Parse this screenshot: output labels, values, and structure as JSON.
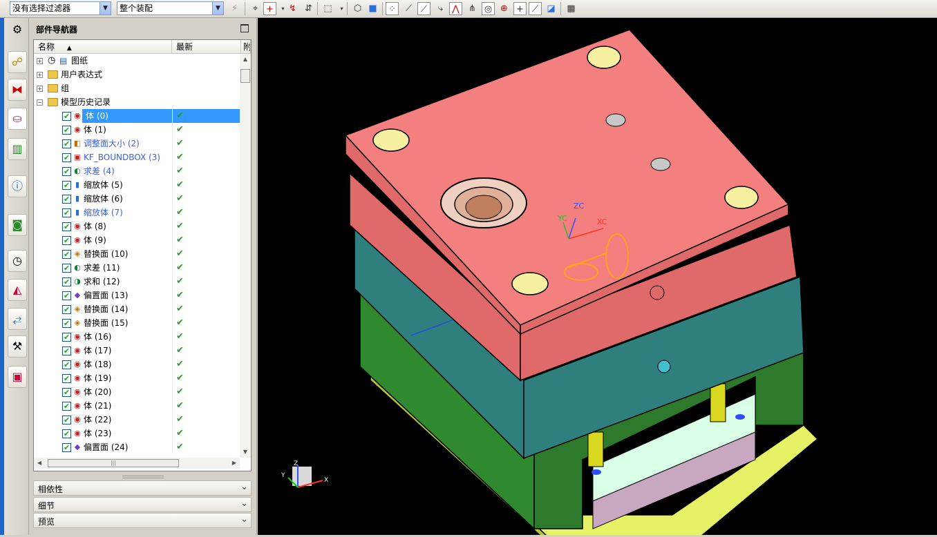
{
  "toolbar": {
    "filter_combo": "没有选择过滤器",
    "scope_combo": "整个装配"
  },
  "navigator": {
    "title": "部件导航器",
    "col_name": "名称",
    "col_latest": "最新",
    "col_extra": "附",
    "folders": [
      {
        "label": "图纸",
        "expanded": false
      },
      {
        "label": "用户表达式",
        "expanded": false
      },
      {
        "label": "组",
        "expanded": false
      },
      {
        "label": "模型历史记录",
        "expanded": true
      }
    ],
    "features": [
      {
        "label": "体 (0)",
        "icon": "body-icon",
        "selected": true,
        "blue": false
      },
      {
        "label": "体 (1)",
        "icon": "body-icon",
        "selected": false,
        "blue": false
      },
      {
        "label": "调整面大小 (2)",
        "icon": "resize-face-icon",
        "selected": false,
        "blue": true
      },
      {
        "label": "KF_BOUNDBOX (3)",
        "icon": "boundbox-icon",
        "selected": false,
        "blue": true
      },
      {
        "label": "求差 (4)",
        "icon": "subtract-icon",
        "selected": false,
        "blue": true
      },
      {
        "label": "缩放体 (5)",
        "icon": "scale-body-icon",
        "selected": false,
        "blue": false
      },
      {
        "label": "缩放体 (6)",
        "icon": "scale-body-icon",
        "selected": false,
        "blue": false
      },
      {
        "label": "缩放体 (7)",
        "icon": "scale-body-icon",
        "selected": false,
        "blue": true
      },
      {
        "label": "体 (8)",
        "icon": "body-icon",
        "selected": false,
        "blue": false
      },
      {
        "label": "体 (9)",
        "icon": "body-icon",
        "selected": false,
        "blue": false
      },
      {
        "label": "替换面 (10)",
        "icon": "replace-face-icon",
        "selected": false,
        "blue": false
      },
      {
        "label": "求差 (11)",
        "icon": "subtract-icon",
        "selected": false,
        "blue": false
      },
      {
        "label": "求和 (12)",
        "icon": "unite-icon",
        "selected": false,
        "blue": false
      },
      {
        "label": "偏置面 (13)",
        "icon": "offset-face-icon",
        "selected": false,
        "blue": false
      },
      {
        "label": "替换面 (14)",
        "icon": "replace-face-icon",
        "selected": false,
        "blue": false
      },
      {
        "label": "替换面 (15)",
        "icon": "replace-face-icon",
        "selected": false,
        "blue": false
      },
      {
        "label": "体 (16)",
        "icon": "body-icon",
        "selected": false,
        "blue": false
      },
      {
        "label": "体 (17)",
        "icon": "body-icon",
        "selected": false,
        "blue": false
      },
      {
        "label": "体 (18)",
        "icon": "body-icon",
        "selected": false,
        "blue": false
      },
      {
        "label": "体 (19)",
        "icon": "body-icon",
        "selected": false,
        "blue": false
      },
      {
        "label": "体 (20)",
        "icon": "body-icon",
        "selected": false,
        "blue": false
      },
      {
        "label": "体 (21)",
        "icon": "body-icon",
        "selected": false,
        "blue": false
      },
      {
        "label": "体 (22)",
        "icon": "body-icon",
        "selected": false,
        "blue": false
      },
      {
        "label": "体 (23)",
        "icon": "body-icon",
        "selected": false,
        "blue": false
      },
      {
        "label": "偏置面 (24)",
        "icon": "offset-face-icon",
        "selected": false,
        "blue": false
      }
    ],
    "sections": [
      "相依性",
      "细节",
      "预览"
    ]
  },
  "viewport": {
    "triad_labels": {
      "zc": "ZC",
      "yc": "YC",
      "xc": "XC"
    },
    "mini_triad": {
      "x": "X",
      "y": "Y",
      "z": "Z"
    },
    "colors": {
      "top_plate": "#f47f7f",
      "cavity_plate": "#2f7f7f",
      "core_plate": "#2f8a2f",
      "base_plate": "#e6f266",
      "background": "#000000"
    }
  }
}
